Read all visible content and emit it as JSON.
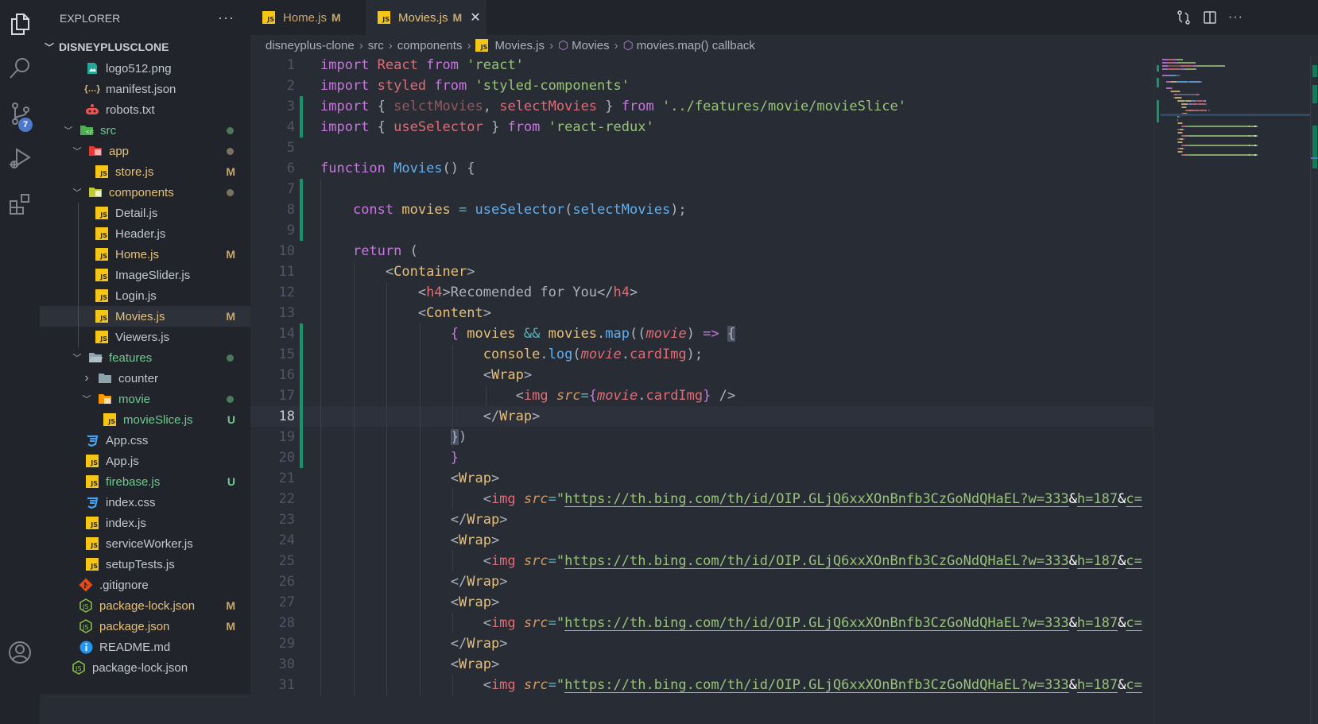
{
  "activity_bar": {
    "items": [
      {
        "name": "explorer",
        "icon": "files-icon"
      },
      {
        "name": "search",
        "icon": "search-icon"
      },
      {
        "name": "source-control",
        "icon": "source-control-icon",
        "badge": "7"
      },
      {
        "name": "run-debug",
        "icon": "debug-icon"
      },
      {
        "name": "extensions",
        "icon": "extensions-icon"
      }
    ],
    "bottom": [
      {
        "name": "accounts",
        "icon": "account-icon"
      }
    ]
  },
  "sidebar": {
    "title": "EXPLORER",
    "more": "···",
    "project": "DISNEYPLUSCLONE",
    "tree": [
      {
        "label": "logo512.png",
        "icon": "image",
        "depth": 2,
        "color": "def"
      },
      {
        "label": "manifest.json",
        "icon": "json",
        "depth": 2,
        "color": "def"
      },
      {
        "label": "robots.txt",
        "icon": "robot",
        "depth": 2,
        "color": "def"
      },
      {
        "label": "src",
        "icon": "folder-src",
        "depth": 1,
        "twist": "open",
        "color": "new",
        "dot": "#4b7a5a"
      },
      {
        "label": "app",
        "icon": "folder-app",
        "depth": 2,
        "twist": "open",
        "color": "mod",
        "dot": "#7d7260"
      },
      {
        "label": "store.js",
        "icon": "js",
        "depth": 3,
        "color": "mod",
        "deco": "M"
      },
      {
        "label": "components",
        "icon": "folder-components",
        "depth": 2,
        "twist": "open",
        "color": "mod",
        "dot": "#7d7260"
      },
      {
        "label": "Detail.js",
        "icon": "js",
        "depth": 3,
        "color": "def"
      },
      {
        "label": "Header.js",
        "icon": "js",
        "depth": 3,
        "color": "def"
      },
      {
        "label": "Home.js",
        "icon": "js",
        "depth": 3,
        "color": "mod",
        "deco": "M"
      },
      {
        "label": "ImageSlider.js",
        "icon": "js",
        "depth": 3,
        "color": "def"
      },
      {
        "label": "Login.js",
        "icon": "js",
        "depth": 3,
        "color": "def"
      },
      {
        "label": "Movies.js",
        "icon": "js",
        "depth": 3,
        "color": "mod",
        "deco": "M",
        "selected": true
      },
      {
        "label": "Viewers.js",
        "icon": "js",
        "depth": 3,
        "color": "def"
      },
      {
        "label": "features",
        "icon": "folder-open",
        "depth": 2,
        "twist": "open",
        "color": "new",
        "dot": "#4b7a5a"
      },
      {
        "label": "counter",
        "icon": "folder",
        "depth": 3,
        "twist": "closed",
        "color": "def"
      },
      {
        "label": "movie",
        "icon": "folder-movie",
        "depth": 3,
        "twist": "open",
        "color": "new",
        "dot": "#4b7a5a"
      },
      {
        "label": "movieSlice.js",
        "icon": "js",
        "depth": 4,
        "color": "new",
        "deco": "U"
      },
      {
        "label": "App.css",
        "icon": "css",
        "depth": 2,
        "color": "def"
      },
      {
        "label": "App.js",
        "icon": "js",
        "depth": 2,
        "color": "def"
      },
      {
        "label": "firebase.js",
        "icon": "js",
        "depth": 2,
        "color": "new",
        "deco": "U"
      },
      {
        "label": "index.css",
        "icon": "css",
        "depth": 2,
        "color": "def"
      },
      {
        "label": "index.js",
        "icon": "js",
        "depth": 2,
        "color": "def"
      },
      {
        "label": "serviceWorker.js",
        "icon": "js",
        "depth": 2,
        "color": "def"
      },
      {
        "label": "setupTests.js",
        "icon": "js",
        "depth": 2,
        "color": "def"
      },
      {
        "label": ".gitignore",
        "icon": "git",
        "depth": 1,
        "color": "def"
      },
      {
        "label": "package-lock.json",
        "icon": "node",
        "depth": 1,
        "color": "mod",
        "deco": "M"
      },
      {
        "label": "package.json",
        "icon": "node",
        "depth": 1,
        "color": "mod",
        "deco": "M"
      },
      {
        "label": "README.md",
        "icon": "info",
        "depth": 1,
        "color": "def"
      },
      {
        "label": "package-lock.json",
        "icon": "node",
        "depth": 0,
        "color": "def"
      }
    ]
  },
  "tabs": [
    {
      "label": "Home.js",
      "status": "M",
      "active": false
    },
    {
      "label": "Movies.js",
      "status": "M",
      "active": true,
      "close": "✕"
    }
  ],
  "editor_actions": [
    "open-changes-icon",
    "split-editor-icon",
    "more-actions-icon"
  ],
  "breadcrumb": {
    "items": [
      "disneyplus-clone",
      "src",
      "components",
      "Movies.js",
      "Movies",
      "movies.map() callback"
    ],
    "separator": "›"
  },
  "editor": {
    "current_line": 18,
    "lines": [
      {
        "n": 1,
        "tokens": [
          [
            "k",
            "import "
          ],
          [
            "v",
            "React "
          ],
          [
            "k",
            "from "
          ],
          [
            "s",
            "'react'"
          ]
        ]
      },
      {
        "n": 2,
        "tokens": [
          [
            "k",
            "import "
          ],
          [
            "v",
            "styled "
          ],
          [
            "k",
            "from "
          ],
          [
            "s",
            "'styled-components'"
          ]
        ]
      },
      {
        "n": 3,
        "tokens": [
          [
            "k",
            "import "
          ],
          [
            "p",
            "{ "
          ],
          [
            "vd",
            "selctMovies"
          ],
          [
            "p",
            ", "
          ],
          [
            "v",
            "selectMovies "
          ],
          [
            "p",
            "} "
          ],
          [
            "k",
            "from "
          ],
          [
            "s",
            "'../features/movie/movieSlice'"
          ]
        ]
      },
      {
        "n": 4,
        "tokens": [
          [
            "k",
            "import "
          ],
          [
            "p",
            "{ "
          ],
          [
            "v",
            "useSelector "
          ],
          [
            "p",
            "} "
          ],
          [
            "k",
            "from "
          ],
          [
            "s",
            "'react-redux'"
          ]
        ]
      },
      {
        "n": 5,
        "tokens": []
      },
      {
        "n": 6,
        "tokens": [
          [
            "k",
            "function "
          ],
          [
            "f",
            "Movies"
          ],
          [
            "p",
            "() {"
          ]
        ]
      },
      {
        "n": 7,
        "tokens": []
      },
      {
        "n": 8,
        "tokens": [
          [
            "p",
            "    "
          ],
          [
            "k",
            "const "
          ],
          [
            "y",
            "movies "
          ],
          [
            "o",
            "= "
          ],
          [
            "f",
            "useSelector"
          ],
          [
            "p",
            "("
          ],
          [
            "f",
            "selectMovies"
          ],
          [
            "p",
            ");"
          ]
        ]
      },
      {
        "n": 9,
        "tokens": []
      },
      {
        "n": 10,
        "tokens": [
          [
            "p",
            "    "
          ],
          [
            "k",
            "return "
          ],
          [
            "p",
            "("
          ]
        ]
      },
      {
        "n": 11,
        "tokens": [
          [
            "p",
            "        <"
          ],
          [
            "y",
            "Container"
          ],
          [
            "p",
            ">"
          ]
        ]
      },
      {
        "n": 12,
        "tokens": [
          [
            "p",
            "            <"
          ],
          [
            "v",
            "h4"
          ],
          [
            "p",
            ">Recomended for You</"
          ],
          [
            "v",
            "h4"
          ],
          [
            "p",
            ">"
          ]
        ]
      },
      {
        "n": 13,
        "tokens": [
          [
            "p",
            "            <"
          ],
          [
            "y",
            "Content"
          ],
          [
            "p",
            ">"
          ]
        ]
      },
      {
        "n": 14,
        "tokens": [
          [
            "p",
            "                "
          ],
          [
            "k",
            "{ "
          ],
          [
            "y",
            "movies "
          ],
          [
            "o",
            "&& "
          ],
          [
            "y",
            "movies"
          ],
          [
            "p",
            "."
          ],
          [
            "f",
            "map"
          ],
          [
            "p",
            "(("
          ],
          [
            "i",
            "movie"
          ],
          [
            "p",
            ") "
          ],
          [
            "k",
            "=> "
          ],
          [
            "bm",
            "{"
          ]
        ]
      },
      {
        "n": 15,
        "tokens": [
          [
            "p",
            "                    "
          ],
          [
            "y",
            "console"
          ],
          [
            "p",
            "."
          ],
          [
            "f",
            "log"
          ],
          [
            "p",
            "("
          ],
          [
            "i",
            "movie"
          ],
          [
            "p",
            "."
          ],
          [
            "v",
            "cardImg"
          ],
          [
            "p",
            ");"
          ]
        ]
      },
      {
        "n": 16,
        "tokens": [
          [
            "p",
            "                    <"
          ],
          [
            "y",
            "Wrap"
          ],
          [
            "p",
            ">"
          ]
        ]
      },
      {
        "n": 17,
        "tokens": [
          [
            "p",
            "                        <"
          ],
          [
            "v",
            "img "
          ],
          [
            "a",
            "src"
          ],
          [
            "o",
            "="
          ],
          [
            "k",
            "{"
          ],
          [
            "i",
            "movie"
          ],
          [
            "p",
            "."
          ],
          [
            "v",
            "cardImg"
          ],
          [
            "k",
            "}"
          ],
          [
            "p",
            " />"
          ]
        ]
      },
      {
        "n": 18,
        "tokens": [
          [
            "p",
            "                    </"
          ],
          [
            "y",
            "Wrap"
          ],
          [
            "p",
            ">"
          ]
        ]
      },
      {
        "n": 19,
        "tokens": [
          [
            "p",
            "                "
          ],
          [
            "bm",
            "}"
          ],
          [
            "p",
            ")"
          ]
        ]
      },
      {
        "n": 20,
        "tokens": [
          [
            "p",
            "                "
          ],
          [
            "k",
            "}"
          ]
        ]
      },
      {
        "n": 21,
        "tokens": [
          [
            "p",
            "                <"
          ],
          [
            "y",
            "Wrap"
          ],
          [
            "p",
            ">"
          ]
        ]
      },
      {
        "n": 22,
        "tokens": [
          [
            "p",
            "                    <"
          ],
          [
            "v",
            "img "
          ],
          [
            "a",
            "src"
          ],
          [
            "o",
            "="
          ],
          [
            "s",
            "\""
          ],
          [
            "url",
            "https://th.bing.com/th/id/OIP.GLjQ6xxXOnBnfb3CzGoNdQHaEL?w=333"
          ],
          [
            "amp",
            "&"
          ],
          [
            "url",
            "h=187"
          ],
          [
            "amp",
            "&"
          ],
          [
            "url",
            "c="
          ]
        ]
      },
      {
        "n": 23,
        "tokens": [
          [
            "p",
            "                </"
          ],
          [
            "y",
            "Wrap"
          ],
          [
            "p",
            ">"
          ]
        ]
      },
      {
        "n": 24,
        "tokens": [
          [
            "p",
            "                <"
          ],
          [
            "y",
            "Wrap"
          ],
          [
            "p",
            ">"
          ]
        ]
      },
      {
        "n": 25,
        "tokens": [
          [
            "p",
            "                    <"
          ],
          [
            "v",
            "img "
          ],
          [
            "a",
            "src"
          ],
          [
            "o",
            "="
          ],
          [
            "s",
            "\""
          ],
          [
            "url",
            "https://th.bing.com/th/id/OIP.GLjQ6xxXOnBnfb3CzGoNdQHaEL?w=333"
          ],
          [
            "amp",
            "&"
          ],
          [
            "url",
            "h=187"
          ],
          [
            "amp",
            "&"
          ],
          [
            "url",
            "c="
          ]
        ]
      },
      {
        "n": 26,
        "tokens": [
          [
            "p",
            "                </"
          ],
          [
            "y",
            "Wrap"
          ],
          [
            "p",
            ">"
          ]
        ]
      },
      {
        "n": 27,
        "tokens": [
          [
            "p",
            "                <"
          ],
          [
            "y",
            "Wrap"
          ],
          [
            "p",
            ">"
          ]
        ]
      },
      {
        "n": 28,
        "tokens": [
          [
            "p",
            "                    <"
          ],
          [
            "v",
            "img "
          ],
          [
            "a",
            "src"
          ],
          [
            "o",
            "="
          ],
          [
            "s",
            "\""
          ],
          [
            "url",
            "https://th.bing.com/th/id/OIP.GLjQ6xxXOnBnfb3CzGoNdQHaEL?w=333"
          ],
          [
            "amp",
            "&"
          ],
          [
            "url",
            "h=187"
          ],
          [
            "amp",
            "&"
          ],
          [
            "url",
            "c="
          ]
        ]
      },
      {
        "n": 29,
        "tokens": [
          [
            "p",
            "                </"
          ],
          [
            "y",
            "Wrap"
          ],
          [
            "p",
            ">"
          ]
        ]
      },
      {
        "n": 30,
        "tokens": [
          [
            "p",
            "                <"
          ],
          [
            "y",
            "Wrap"
          ],
          [
            "p",
            ">"
          ]
        ]
      },
      {
        "n": 31,
        "tokens": [
          [
            "p",
            "                    <"
          ],
          [
            "v",
            "img "
          ],
          [
            "a",
            "src"
          ],
          [
            "o",
            "="
          ],
          [
            "s",
            "\""
          ],
          [
            "url",
            "https://th.bing.com/th/id/OIP.GLjQ6xxXOnBnfb3CzGoNdQHaEL?w=333"
          ],
          [
            "amp",
            "&"
          ],
          [
            "url",
            "h=187"
          ],
          [
            "amp",
            "&"
          ],
          [
            "url",
            "c="
          ]
        ]
      }
    ],
    "git_added_lines": [
      [
        3,
        4
      ],
      [
        7,
        9
      ],
      [
        14,
        20
      ]
    ]
  },
  "colors": {
    "git_added": "#109868",
    "modified": "#e5c07b",
    "untracked": "#73c991",
    "badge": "#4d78cc"
  }
}
